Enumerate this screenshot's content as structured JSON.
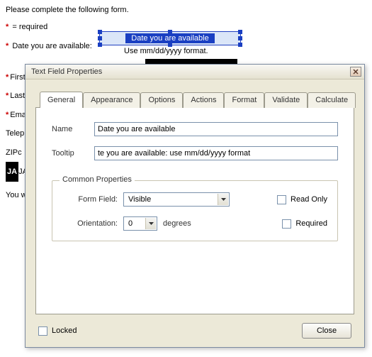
{
  "form": {
    "intro": "Please complete the following form.",
    "required_legend": "= required",
    "date_label": "Date you are available:",
    "date_field_name": "Date you are available",
    "date_hint": "Use mm/dd/yyyy format."
  },
  "bg_labels": {
    "first": "First",
    "last": "Last",
    "ema": "Ema",
    "teleph": "Teleph",
    "zipc": "ZIPc",
    "jaws_badge": "JA",
    "jaws_rest": "JAV",
    "youwi": "You wi"
  },
  "dialog": {
    "title": "Text Field Properties",
    "tabs": [
      "General",
      "Appearance",
      "Options",
      "Actions",
      "Format",
      "Validate",
      "Calculate"
    ],
    "active_tab": 0,
    "name_label": "Name",
    "name_value": "Date you are available",
    "tooltip_label": "Tooltip",
    "tooltip_value": "te you are available: use mm/dd/yyyy format",
    "group_title": "Common Properties",
    "form_field_label": "Form Field:",
    "form_field_value": "Visible",
    "orientation_label": "Orientation:",
    "orientation_value": "0",
    "orientation_unit": "degrees",
    "readonly_label": "Read Only",
    "required_label": "Required",
    "locked_label": "Locked",
    "close_label": "Close"
  }
}
